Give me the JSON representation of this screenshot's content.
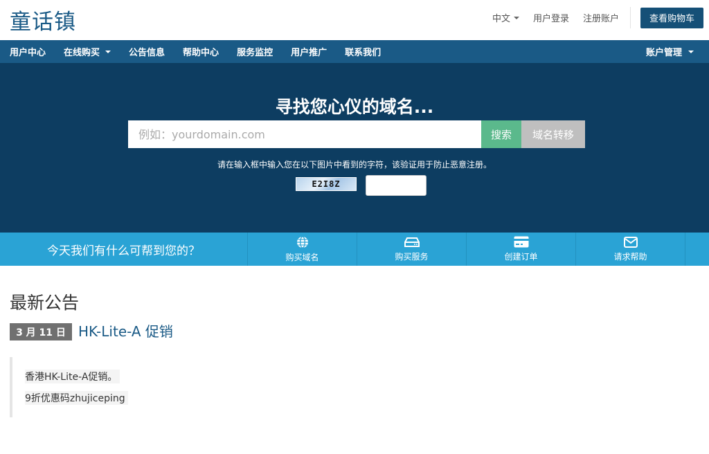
{
  "header": {
    "logo": "童话镇",
    "language": "中文",
    "login": "用户登录",
    "register": "注册账户",
    "cart": "查看购物车"
  },
  "nav": {
    "items": [
      "用户中心",
      "在线购买",
      "公告信息",
      "帮助中心",
      "服务监控",
      "用户推广",
      "联系我们"
    ],
    "account": "账户管理"
  },
  "hero": {
    "title": "寻找您心仪的域名...",
    "search_placeholder": "例如：yourdomain.com",
    "search_button": "搜索",
    "transfer_button": "域名转移",
    "captcha_note": "请在输入框中输入您在以下图片中看到的字符，该验证用于防止恶意注册。",
    "captcha_code": "E2I8Z"
  },
  "helpbar": {
    "text": "今天我们有什么可帮到您的？",
    "buttons": [
      {
        "label": "购买域名",
        "icon": "globe-icon"
      },
      {
        "label": "购买服务",
        "icon": "server-icon"
      },
      {
        "label": "创建订单",
        "icon": "credit-card-icon"
      },
      {
        "label": "请求帮助",
        "icon": "envelope-icon"
      }
    ]
  },
  "announcements": {
    "heading": "最新公告",
    "items": [
      {
        "date": "3 月 11 日",
        "title": "HK-Lite-A 促销",
        "lines": [
          "香港HK-Lite-A促销。",
          "9折优惠码zhujiceping"
        ]
      }
    ]
  },
  "colors": {
    "brand": "#1a5a86",
    "hero_bg": "#0d3d61",
    "help_bg": "#2aa3d5",
    "search_green": "#5bb98c"
  }
}
